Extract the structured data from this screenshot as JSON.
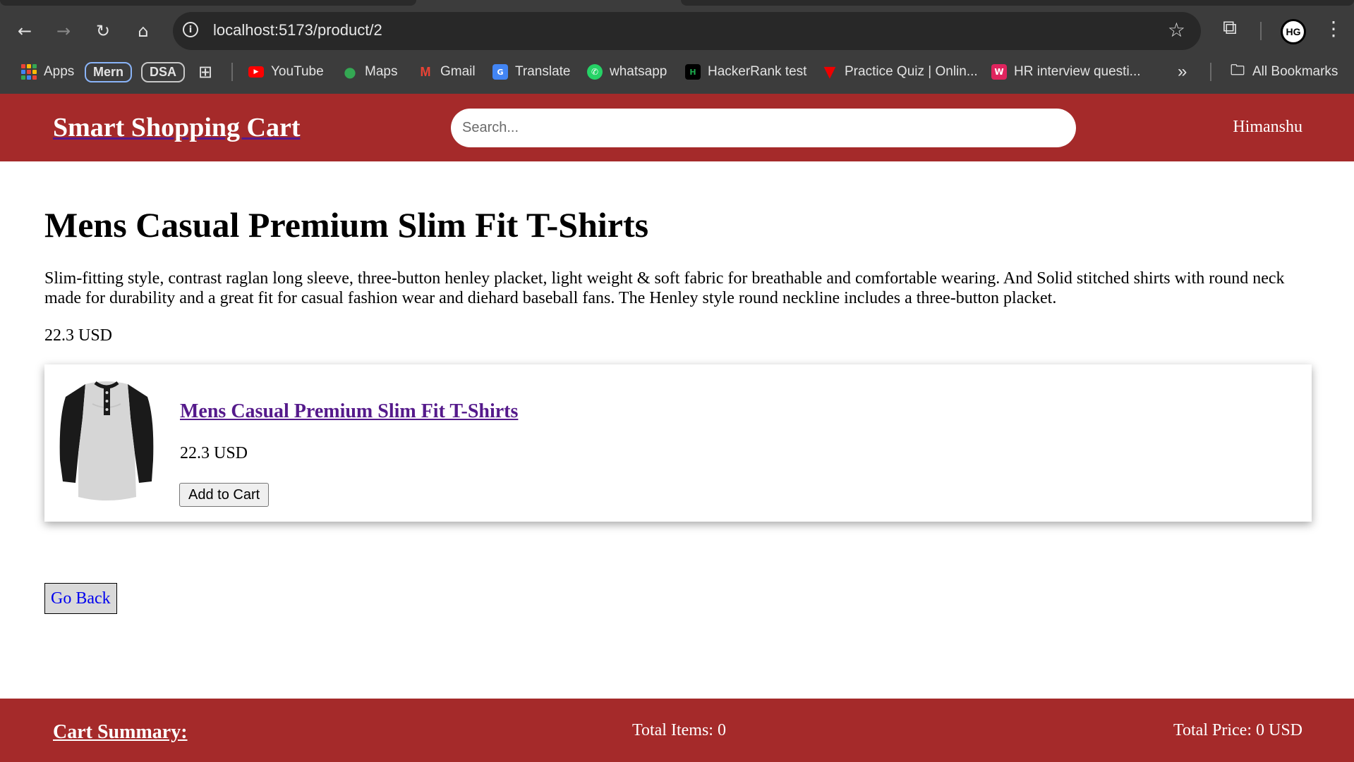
{
  "browser": {
    "url": "localhost:5173/product/2",
    "bookmarks": [
      {
        "label": "Apps",
        "icon": "apps-grid-icon"
      },
      {
        "label": "Mern",
        "icon": "pill"
      },
      {
        "label": "DSA",
        "icon": "pill"
      },
      {
        "label": "",
        "icon": "tab-groups-icon"
      },
      {
        "label": "YouTube",
        "icon": "youtube-icon"
      },
      {
        "label": "Maps",
        "icon": "maps-icon"
      },
      {
        "label": "Gmail",
        "icon": "gmail-icon"
      },
      {
        "label": "Translate",
        "icon": "translate-icon"
      },
      {
        "label": "whatsapp",
        "icon": "whatsapp-icon"
      },
      {
        "label": "HackerRank test",
        "icon": "hackerrank-icon"
      },
      {
        "label": "Practice Quiz | Onlin...",
        "icon": "quiz-icon"
      },
      {
        "label": "HR interview questi...",
        "icon": "w-icon"
      }
    ],
    "all_bookmarks": "All Bookmarks",
    "profile_initials": "HG"
  },
  "header": {
    "title": "Smart Shopping Cart",
    "search_placeholder": "Search...",
    "username": "Himanshu"
  },
  "product": {
    "title": "Mens Casual Premium Slim Fit T-Shirts",
    "description": "Slim-fitting style, contrast raglan long sleeve, three-button henley placket, light weight & soft fabric for breathable and comfortable wearing. And Solid stitched shirts with round neck made for durability and a great fit for casual fashion wear and diehard baseball fans. The Henley style round neckline includes a three-button placket.",
    "price": "22.3 USD"
  },
  "card": {
    "title": "Mens Casual Premium Slim Fit T-Shirts",
    "price": "22.3 USD",
    "add_to_cart": "Add to Cart"
  },
  "go_back": "Go Back",
  "footer": {
    "cart_summary": "Cart Summary:",
    "total_items": "Total Items: 0",
    "total_price": "Total Price: 0 USD"
  },
  "colors": {
    "brand": "#a52a2a",
    "link_visited": "#551a8b",
    "link": "#0000ee"
  }
}
